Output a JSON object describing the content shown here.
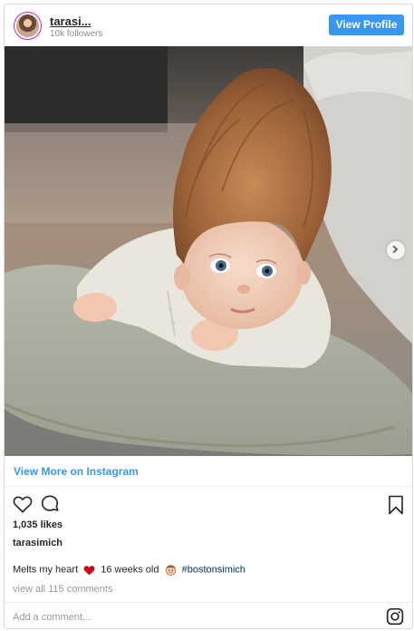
{
  "header": {
    "username": "tarasi...",
    "followers": "10k followers",
    "view_profile_label": "View Profile"
  },
  "post": {
    "has_next_image": true,
    "view_more_label": "View More on Instagram",
    "likes": "1,035 likes",
    "author": "tarasimich",
    "caption": {
      "text_before": "Melts my heart",
      "heart_emoji": "red-heart-icon",
      "text_middle": "16 weeks old",
      "baby_emoji": "baby-face-icon",
      "hashtag": "#bostonsimich"
    },
    "view_comments_label": "view all 115 comments"
  },
  "comment_box": {
    "placeholder": "Add a comment..."
  },
  "icons": {
    "like": "heart-outline-icon",
    "comment": "comment-bubble-icon",
    "save": "bookmark-icon",
    "instagram": "instagram-logo-icon"
  },
  "colors": {
    "accent": "#3897f0",
    "hashtag": "#003569",
    "muted": "#8e8e8e",
    "text": "#262626"
  }
}
